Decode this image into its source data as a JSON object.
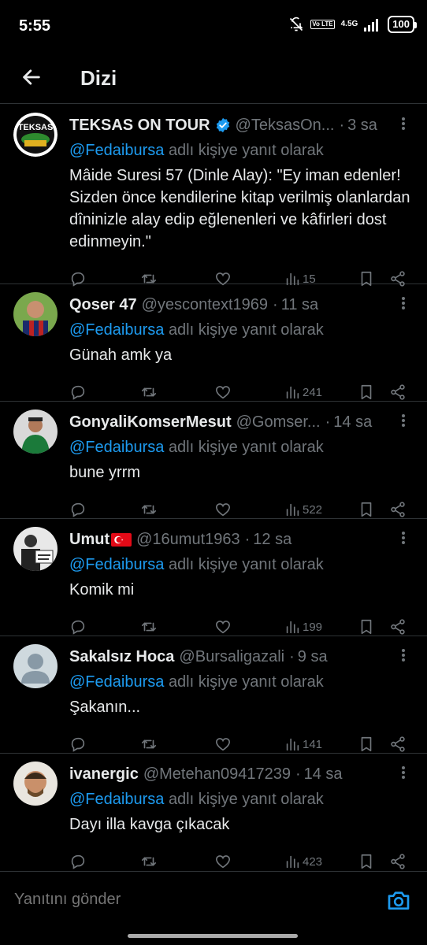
{
  "status": {
    "time": "5:55",
    "volte": "Vo LTE",
    "network": "4.5G",
    "battery": "100"
  },
  "header": {
    "title": "Dizi"
  },
  "reply_prefix_suffix": "adlı kişiye yanıt olarak",
  "tweets": [
    {
      "name": "TEKSAS ON TOUR",
      "verified": true,
      "handle": "@TeksasOn...",
      "time": "3 sa",
      "reply_to": "@Fedaibursa",
      "text": "Mâide Suresi 57 (Dinle Alay): \"Ey iman edenler! Sizden önce kendilerine kitap verilmiş olanlardan dîninizle alay edip eğlenenleri ve kâfirleri dost edinmeyin.\"",
      "views": "15"
    },
    {
      "name": "Qoser 47",
      "handle": "@yescontext1969",
      "time": "11 sa",
      "reply_to": "@Fedaibursa",
      "text": "Günah amk ya",
      "views": "241"
    },
    {
      "name": "GonyaliKomserMesut",
      "handle": "@Gomser...",
      "time": "14 sa",
      "reply_to": "@Fedaibursa",
      "text": "bune yrrm",
      "views": "522"
    },
    {
      "name": "Umut",
      "flag": "🇹🇷",
      "handle": "@16umut1963",
      "time": "12 sa",
      "reply_to": "@Fedaibursa",
      "text": "Komik mi",
      "views": "199"
    },
    {
      "name": "Sakalsız Hoca",
      "handle": "@Bursaligazali",
      "time": "9 sa",
      "reply_to": "@Fedaibursa",
      "text": "Şakanın...",
      "views": "141"
    },
    {
      "name": "ivanergic",
      "handle": "@Metehan09417239",
      "time": "14 sa",
      "reply_to": "@Fedaibursa",
      "text": "Dayı illa kavga çıkacak",
      "views": "423"
    }
  ],
  "compose": {
    "placeholder": "Yanıtını gönder"
  },
  "colors": {
    "accent": "#1d9bf0",
    "muted": "#71767b",
    "text": "#e7e9ea",
    "divider": "#2f3336"
  }
}
